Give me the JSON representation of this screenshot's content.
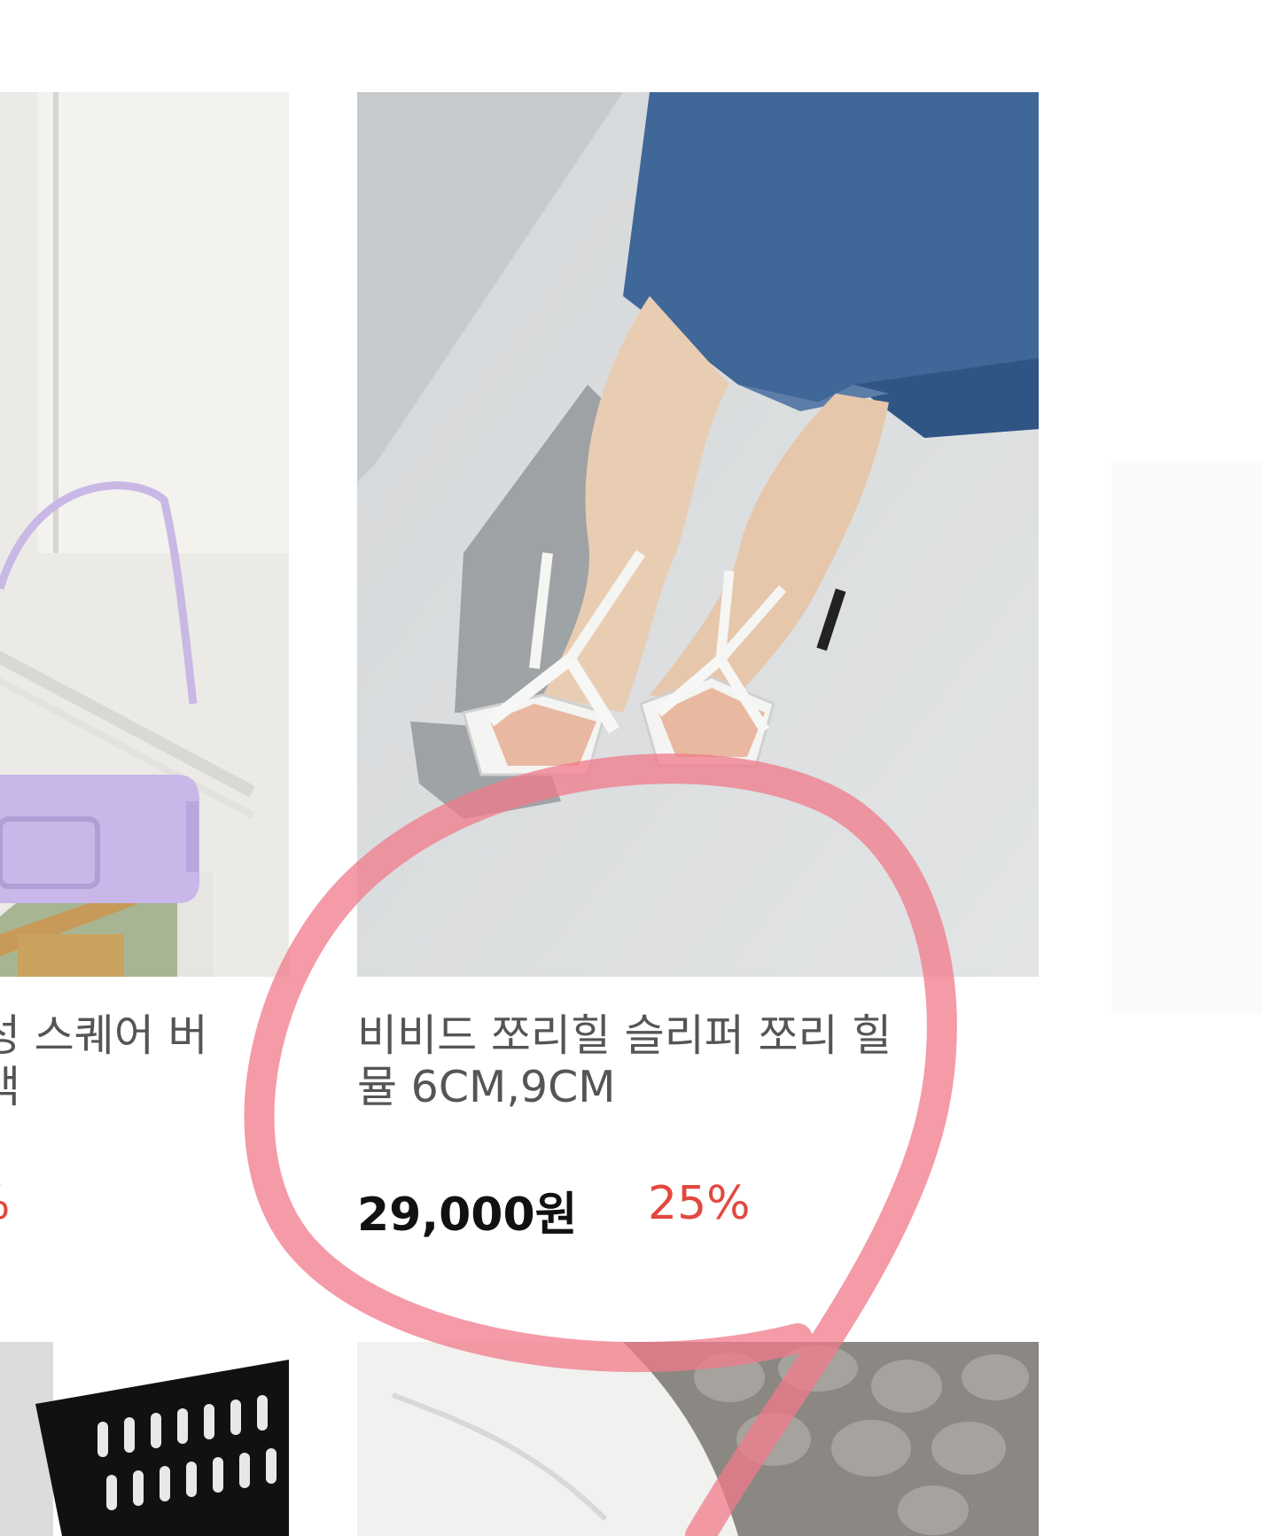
{
  "products": [
    {
      "title_line1": "성 스퀘어 버",
      "title_line2": "백",
      "discount": "%"
    },
    {
      "title_line1": "비비드 쪼리힐 슬리퍼 쪼리 힐",
      "title_line2": "뮬 6CM,9CM",
      "price": "29,000원",
      "discount": "25%"
    }
  ],
  "colors": {
    "discount": "#e3483f",
    "annotation_circle": "#f07a8a"
  }
}
